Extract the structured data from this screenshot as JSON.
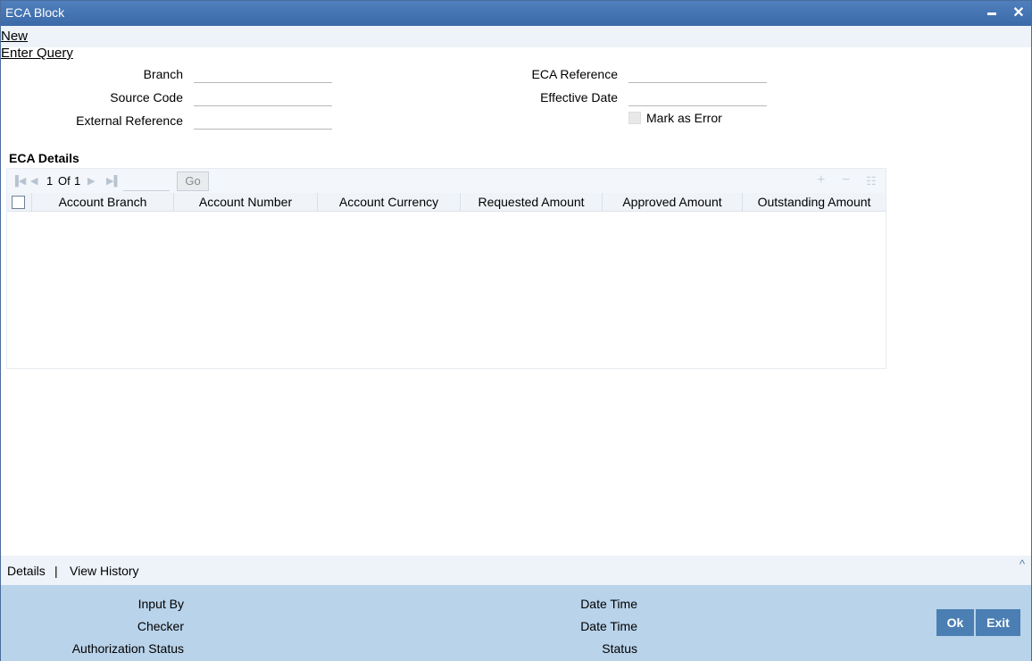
{
  "window": {
    "title": "ECA Block",
    "minimize_glyph": "▬",
    "close_glyph": "✕"
  },
  "menu": {
    "new": "New",
    "enter_query": "Enter Query"
  },
  "form": {
    "branch_label": "Branch",
    "source_code_label": "Source Code",
    "external_reference_label": "External Reference",
    "eca_reference_label": "ECA Reference",
    "effective_date_label": "Effective Date",
    "mark_as_error_label": "Mark as Error",
    "branch_value": "",
    "source_code_value": "",
    "external_reference_value": "",
    "eca_reference_value": "",
    "effective_date_value": ""
  },
  "eca_details": {
    "title": "ECA Details",
    "pager": {
      "current": "1",
      "of": "Of",
      "total": "1",
      "go": "Go"
    },
    "columns": [
      "Account Branch",
      "Account Number",
      "Account Currency",
      "Requested Amount",
      "Approved Amount",
      "Outstanding Amount"
    ],
    "rows": []
  },
  "footer_tabs": {
    "details": "Details",
    "separator": "|",
    "view_history": "View History",
    "collapse_glyph": "^"
  },
  "audit": {
    "input_by": "Input By",
    "checker": "Checker",
    "authorization_status": "Authorization Status",
    "date_time_1": "Date Time",
    "date_time_2": "Date Time",
    "status": "Status",
    "ok": "Ok",
    "exit": "Exit"
  }
}
